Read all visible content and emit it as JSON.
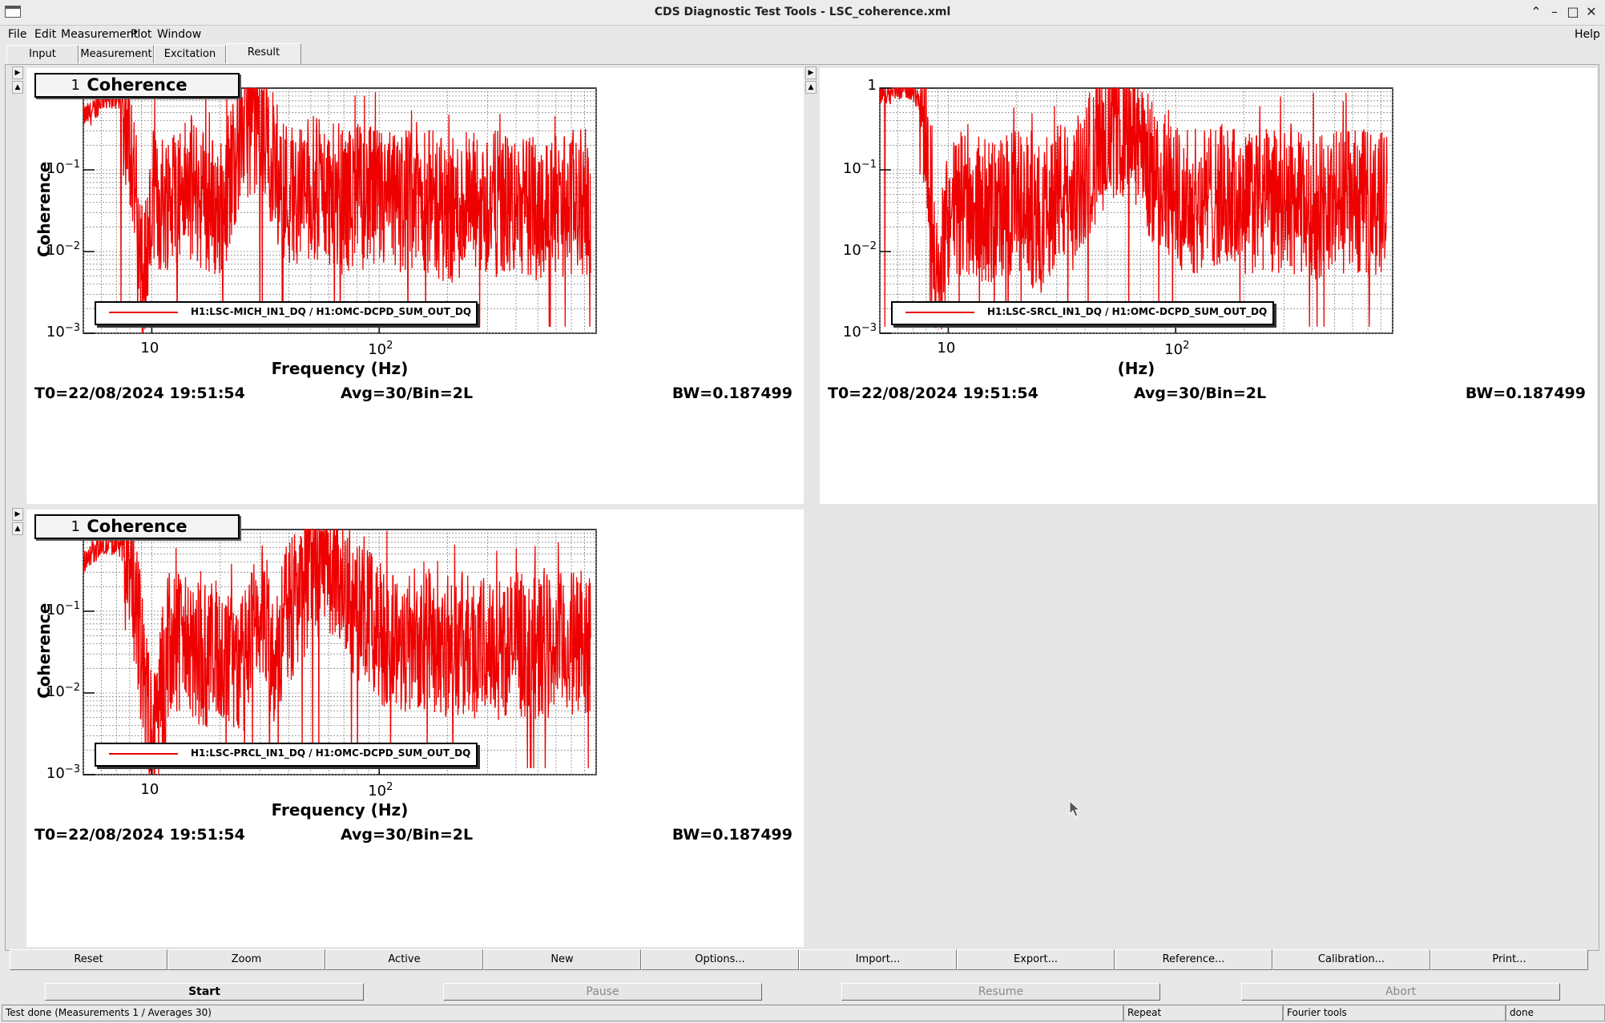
{
  "window": {
    "title": "CDS Diagnostic Test Tools - LSC_coherence.xml"
  },
  "menu": {
    "file": "File",
    "edit": "Edit",
    "measurement": "Measurement",
    "plot": "Plot",
    "window": "Window",
    "help": "Help"
  },
  "tabs": [
    "Input",
    "Measurement",
    "Excitation",
    "Result"
  ],
  "panels": [
    {
      "title": "Coherence",
      "ylabel": "Coherence",
      "xlabel": "Frequency (Hz)",
      "legend": "H1:LSC-MICH_IN1_DQ / H1:OMC-DCPD_SUM_OUT_DQ",
      "t0": "T0=22/08/2024 19:51:54",
      "avg": "Avg=30/Bin=2L",
      "bw": "BW=0.187499"
    },
    {
      "title": "",
      "ylabel": "",
      "xlabel": "(Hz)",
      "legend": "H1:LSC-SRCL_IN1_DQ / H1:OMC-DCPD_SUM_OUT_DQ",
      "t0": "T0=22/08/2024 19:51:54",
      "avg": "Avg=30/Bin=2L",
      "bw": "BW=0.187499"
    },
    {
      "title": "Coherence",
      "ylabel": "Coherence",
      "xlabel": "Frequency (Hz)",
      "legend": "H1:LSC-PRCL_IN1_DQ / H1:OMC-DCPD_SUM_OUT_DQ",
      "t0": "T0=22/08/2024 19:51:54",
      "avg": "Avg=30/Bin=2L",
      "bw": "BW=0.187499"
    }
  ],
  "ticks": {
    "y": [
      "1",
      "10",
      "10",
      "10"
    ],
    "y_exp": [
      "",
      "−1",
      "−2",
      "−3"
    ],
    "x": [
      "10",
      "10"
    ],
    "x_exp": [
      "",
      "2"
    ]
  },
  "toolbar": [
    "Reset",
    "Zoom",
    "Active",
    "New",
    "Options...",
    "Import...",
    "Export...",
    "Reference...",
    "Calibration...",
    "Print..."
  ],
  "controls": {
    "start": "Start",
    "pause": "Pause",
    "resume": "Resume",
    "abort": "Abort"
  },
  "status": {
    "message": "Test done (Measurements 1 / Averages 30)",
    "repeat": "Repeat",
    "fourier": "Fourier tools",
    "state": "done"
  },
  "colors": {
    "trace": "#ee0000",
    "background": "#e8e8e8"
  },
  "chart_data": [
    {
      "type": "line",
      "title": "Coherence",
      "xlabel": "Frequency (Hz)",
      "ylabel": "Coherence",
      "xscale": "log",
      "yscale": "log",
      "xlim": [
        5,
        900
      ],
      "ylim": [
        0.001,
        1
      ],
      "grid": true,
      "legend_position": "bottom-left",
      "series": [
        {
          "name": "H1:LSC-MICH_IN1_DQ / H1:OMC-DCPD_SUM_OUT_DQ",
          "x": [
            5,
            5.5,
            6,
            6.5,
            7,
            7.5,
            8,
            8.5,
            9,
            10,
            12,
            15,
            20,
            25,
            30,
            35,
            40,
            50,
            60,
            70,
            80,
            100,
            120,
            150,
            200,
            300,
            400,
            500,
            700,
            850
          ],
          "y": [
            0.45,
            0.5,
            0.75,
            0.8,
            0.75,
            0.6,
            0.3,
            0.05,
            0.003,
            0.03,
            0.05,
            0.06,
            0.03,
            0.35,
            0.4,
            0.1,
            0.05,
            0.06,
            0.05,
            0.04,
            0.05,
            0.04,
            0.04,
            0.05,
            0.03,
            0.04,
            0.035,
            0.035,
            0.04,
            0.04
          ]
        }
      ]
    },
    {
      "type": "line",
      "xlabel": "(Hz)",
      "xscale": "log",
      "yscale": "log",
      "xlim": [
        5,
        900
      ],
      "ylim": [
        0.001,
        1
      ],
      "grid": true,
      "legend_position": "bottom-left",
      "series": [
        {
          "name": "H1:LSC-SRCL_IN1_DQ / H1:OMC-DCPD_SUM_OUT_DQ",
          "x": [
            5,
            5.5,
            6,
            6.5,
            7,
            7.5,
            8,
            8.5,
            9,
            10,
            12,
            15,
            20,
            25,
            30,
            35,
            40,
            50,
            60,
            70,
            80,
            100,
            120,
            150,
            200,
            300,
            400,
            500,
            700,
            850
          ],
          "y": [
            0.9,
            0.9,
            1.0,
            1.0,
            0.95,
            0.7,
            0.3,
            0.05,
            0.002,
            0.03,
            0.04,
            0.03,
            0.04,
            0.02,
            0.06,
            0.04,
            0.1,
            0.3,
            0.35,
            0.2,
            0.08,
            0.05,
            0.04,
            0.05,
            0.04,
            0.04,
            0.035,
            0.04,
            0.04,
            0.04
          ]
        }
      ]
    },
    {
      "type": "line",
      "title": "Coherence",
      "xlabel": "Frequency (Hz)",
      "ylabel": "Coherence",
      "xscale": "log",
      "yscale": "log",
      "xlim": [
        5,
        900
      ],
      "ylim": [
        0.001,
        1
      ],
      "grid": true,
      "legend_position": "bottom-left",
      "series": [
        {
          "name": "H1:LSC-PRCL_IN1_DQ / H1:OMC-DCPD_SUM_OUT_DQ",
          "x": [
            5,
            5.5,
            6,
            6.5,
            7,
            7.5,
            8,
            8.5,
            9,
            10,
            12,
            15,
            20,
            25,
            30,
            35,
            40,
            50,
            60,
            70,
            80,
            100,
            120,
            150,
            200,
            300,
            400,
            500,
            700,
            850
          ],
          "y": [
            0.4,
            0.55,
            0.6,
            0.7,
            0.65,
            0.55,
            0.3,
            0.1,
            0.03,
            0.002,
            0.05,
            0.03,
            0.03,
            0.02,
            0.1,
            0.03,
            0.1,
            0.3,
            0.35,
            0.25,
            0.1,
            0.06,
            0.04,
            0.05,
            0.04,
            0.035,
            0.04,
            0.035,
            0.04,
            0.04
          ]
        }
      ]
    }
  ]
}
